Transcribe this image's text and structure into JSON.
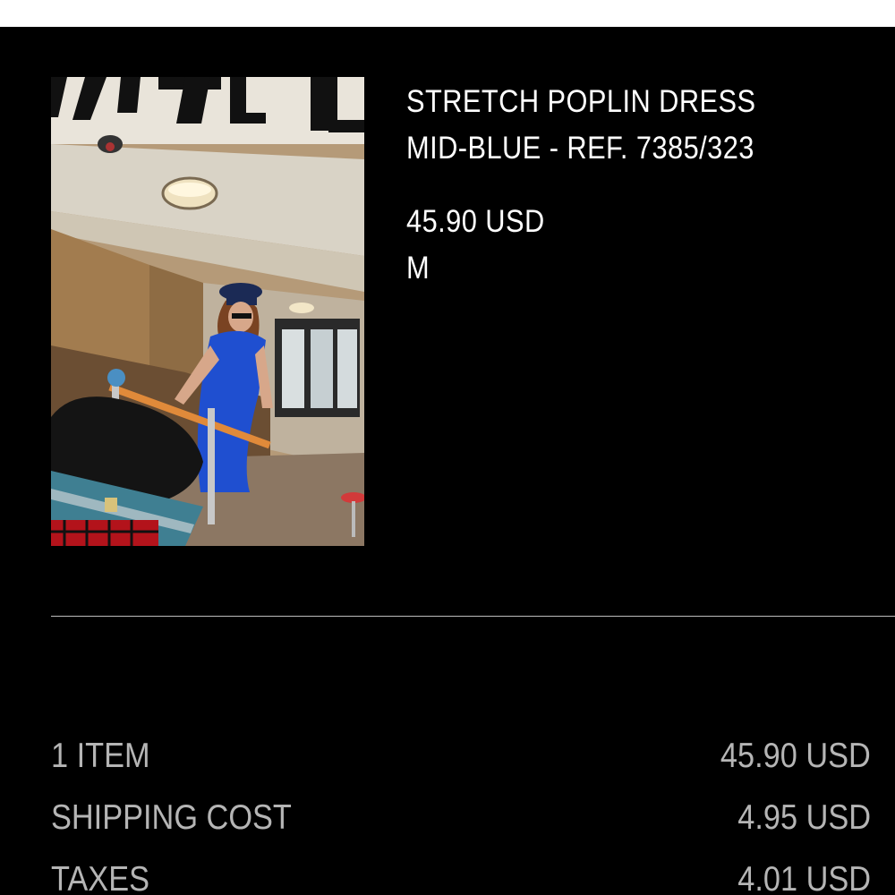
{
  "product": {
    "name": "STRETCH POPLIN DRESS",
    "color_ref": "MID-BLUE - REF. 7385/323",
    "price": "45.90 USD",
    "size": "M",
    "image_icon": "product-photo"
  },
  "summary": {
    "rows": [
      {
        "label": "1 ITEM",
        "value": "45.90 USD"
      },
      {
        "label": "SHIPPING COST",
        "value": "4.95 USD"
      },
      {
        "label": "TAXES",
        "value": "4.01 USD"
      }
    ]
  },
  "colors": {
    "background": "#000000",
    "text_primary": "#ffffff",
    "text_secondary": "#b5b5b5",
    "divider": "#bdbdbd"
  }
}
